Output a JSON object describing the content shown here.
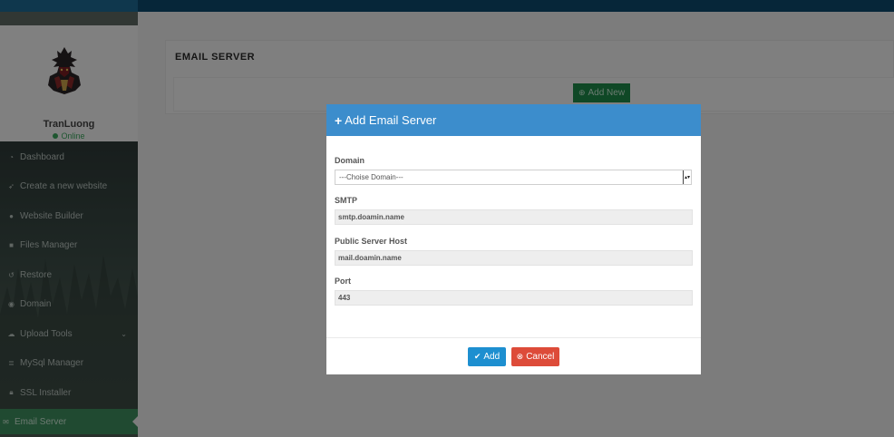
{
  "sidebar": {
    "profile": {
      "username": "TranLuong",
      "status": "Online"
    },
    "items": [
      {
        "label": "Dashboard",
        "icon": "gauge-icon"
      },
      {
        "label": "Create a new website",
        "icon": "rocket-icon"
      },
      {
        "label": "Website Builder",
        "icon": "globe-icon"
      },
      {
        "label": "Files Manager",
        "icon": "folder-icon"
      },
      {
        "label": "Restore",
        "icon": "history-icon"
      },
      {
        "label": "Domain",
        "icon": "compass-icon"
      },
      {
        "label": "Upload Tools",
        "icon": "cloud-upload-icon"
      },
      {
        "label": "MySql Manager",
        "icon": "database-icon"
      },
      {
        "label": "SSL Installer",
        "icon": "lock-icon"
      },
      {
        "label": "Email Server",
        "icon": "envelope-icon"
      }
    ]
  },
  "content": {
    "title": "EMAIL SERVER",
    "add_new_label": "Add New"
  },
  "modal": {
    "title": "Add Email Server",
    "domain_label": "Domain",
    "domain_selected": "---Choise Domain---",
    "smtp_label": "SMTP",
    "smtp_value": "smtp.doamin.name",
    "host_label": "Public Server Host",
    "host_value": "mail.doamin.name",
    "port_label": "Port",
    "port_value": "443",
    "add_label": "Add",
    "cancel_label": "Cancel"
  },
  "colors": {
    "modal_header": "#3c8dcc",
    "add_button": "#1d8fd0",
    "cancel_button": "#dd4b39",
    "add_new_button": "#1e8a4a",
    "active_menu": "#3e8e5e"
  }
}
